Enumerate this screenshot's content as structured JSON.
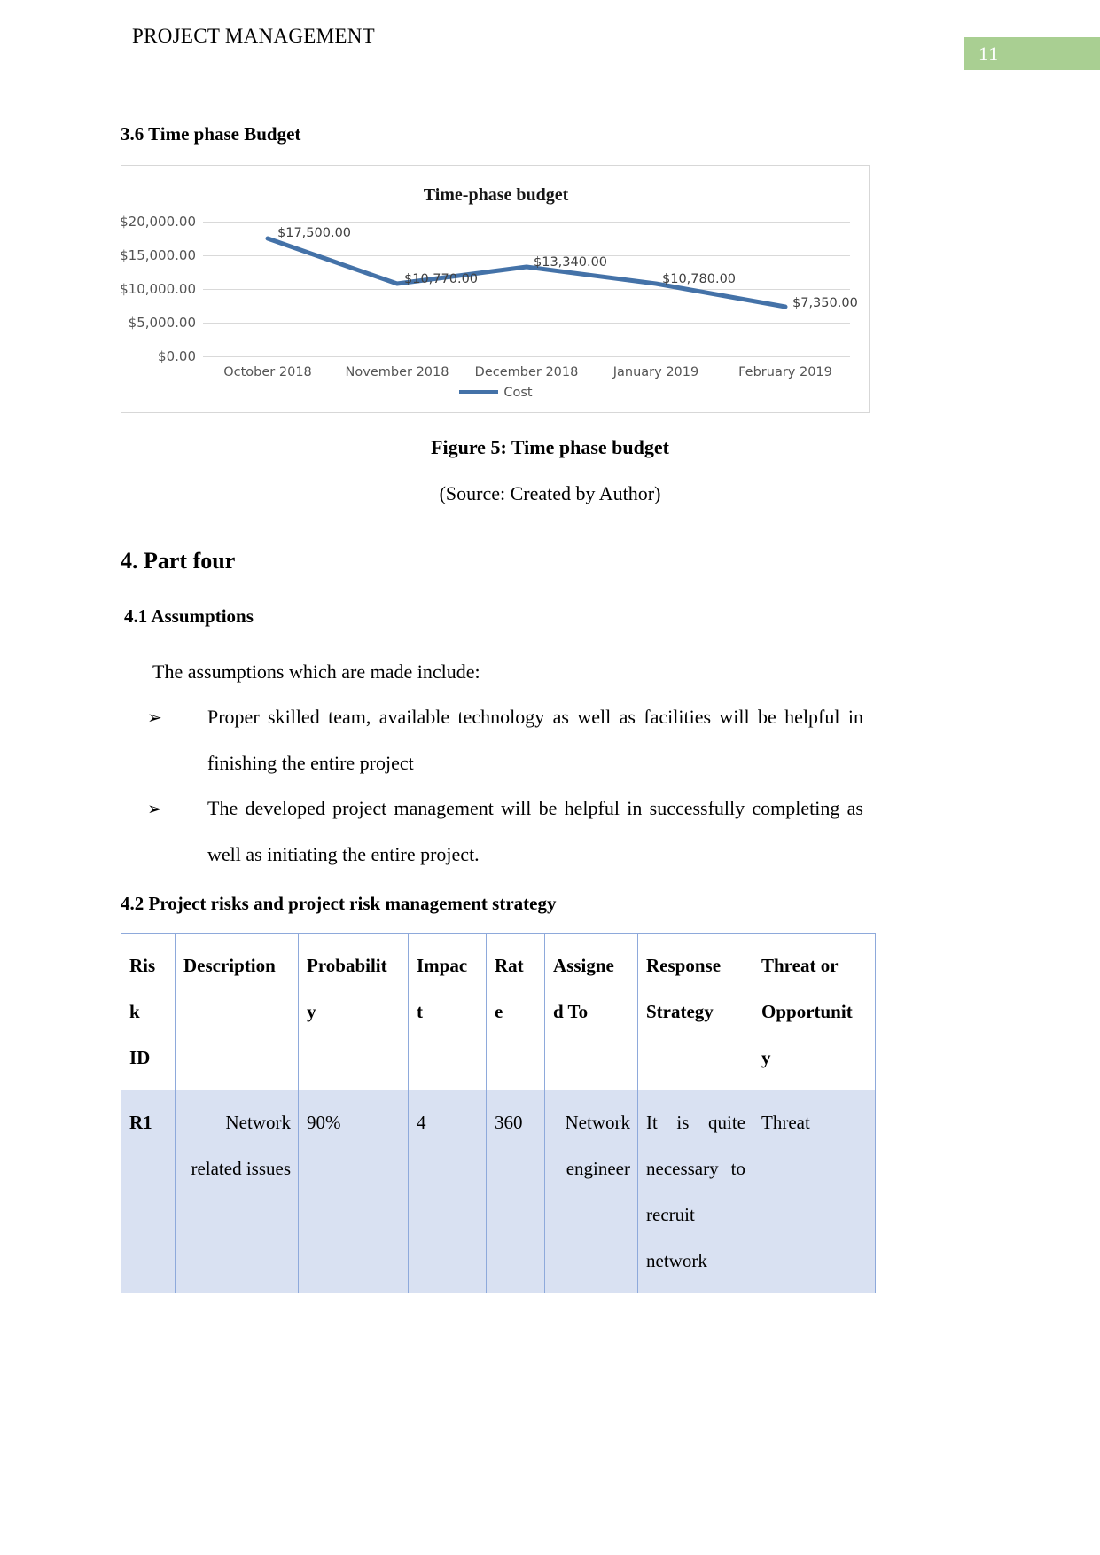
{
  "header": {
    "document_title": "PROJECT MANAGEMENT",
    "page_number": "11",
    "page_number_bg": "#a9cf92"
  },
  "sections": {
    "s36_heading": "3.6 Time phase Budget",
    "figure_caption": "Figure 5: Time phase budget",
    "figure_source": "(Source: Created by Author)",
    "part4_heading": "4. Part four",
    "s41_heading": "4.1 Assumptions",
    "s41_intro": "The assumptions which are made include:",
    "s42_heading": "4.2 Project risks and project risk management strategy"
  },
  "assumptions_bullets": [
    {
      "marker": "➢",
      "text": "Proper skilled team, available technology as well as facilities will be helpful in finishing the entire project"
    },
    {
      "marker": "➢",
      "text": "The developed project management will be helpful in successfully completing as  well as initiating the entire project."
    }
  ],
  "chart_data": {
    "type": "line",
    "title": "Time-phase budget",
    "xlabel": "",
    "ylabel": "",
    "categories": [
      "October 2018",
      "November 2018",
      "December 2018",
      "January 2019",
      "February 2019"
    ],
    "series": [
      {
        "name": "Cost",
        "color": "#4472a8",
        "values": [
          17500,
          10770,
          13340,
          10780,
          7350
        ],
        "data_labels": [
          "$17,500.00",
          "$10,770.00",
          "$13,340.00",
          "$10,780.00",
          "$7,350.00"
        ]
      }
    ],
    "ylim": [
      0,
      20000
    ],
    "yticks": [
      0,
      5000,
      10000,
      15000,
      20000
    ],
    "ytick_labels": [
      "$0.00",
      "$5,000.00",
      "$10,000.00",
      "$15,000.00",
      "$20,000.00"
    ],
    "grid": true,
    "legend_position": "bottom",
    "legend_entries": [
      "Cost"
    ]
  },
  "risk_table": {
    "columns": [
      "Risk ID",
      "Description",
      "Probability",
      "Impact",
      "Rate",
      "Assigned To",
      "Response Strategy",
      "Threat or Opportunity"
    ],
    "headers": [
      "Ris\nk\nID",
      "Description",
      "Probabilit\ny",
      "Impac\nt",
      "Rat\ne",
      "Assigne\nd To",
      "Response\nStrategy",
      "Threat or\nOpportunit\ny"
    ],
    "rows": [
      {
        "risk_id": "R1",
        "description": "Network related issues",
        "probability": "90%",
        "impact": "4",
        "rate": "360",
        "assigned_to": "Network engineer",
        "response_strategy": "It is quite necessary to recruit network",
        "threat_or_opportunity": "Threat"
      }
    ],
    "row_bg": "#d9e1f2",
    "border_color": "#8ea9db"
  }
}
